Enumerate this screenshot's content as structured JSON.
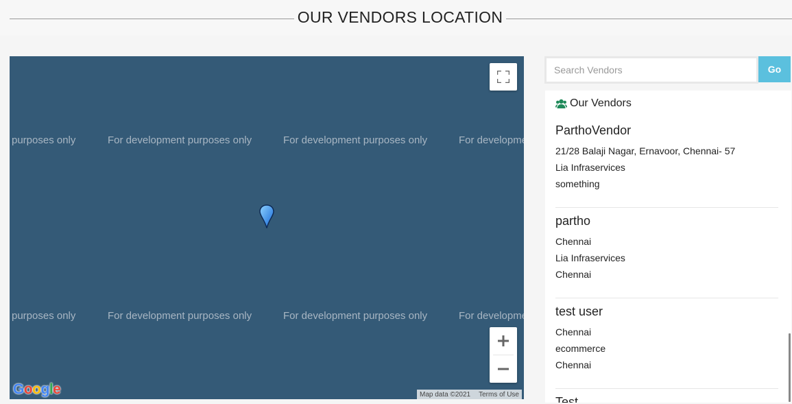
{
  "page": {
    "title": "OUR VENDORS LOCATION"
  },
  "map": {
    "watermark_text": "For development purposes only",
    "fullscreen_icon": "fullscreen-icon",
    "marker_icon": "map-pin-icon",
    "marker_color": "#1e90ff",
    "zoom_in_label": "+",
    "zoom_out_label": "−",
    "google_logo": "Google",
    "map_data": "Map data ©2021",
    "terms": "Terms of Use",
    "background": "#345a77"
  },
  "search": {
    "placeholder": "Search Vendors",
    "value": "",
    "go_label": "Go",
    "go_color": "#5bc0de"
  },
  "vendors_panel": {
    "header_icon": "users-icon",
    "header_icon_color": "#1f8a5a",
    "header_label": "Our Vendors",
    "vendors": [
      {
        "name": "ParthoVendor",
        "address": "21/28 Balaji Nagar, Ernavoor, Chennai- 57",
        "company": "Lia Infraservices",
        "extra": "something"
      },
      {
        "name": "partho",
        "address": "Chennai",
        "company": "Lia Infraservices",
        "extra": "Chennai"
      },
      {
        "name": "test user",
        "address": "Chennai",
        "company": "ecommerce",
        "extra": "Chennai"
      },
      {
        "name": "Test"
      }
    ]
  }
}
